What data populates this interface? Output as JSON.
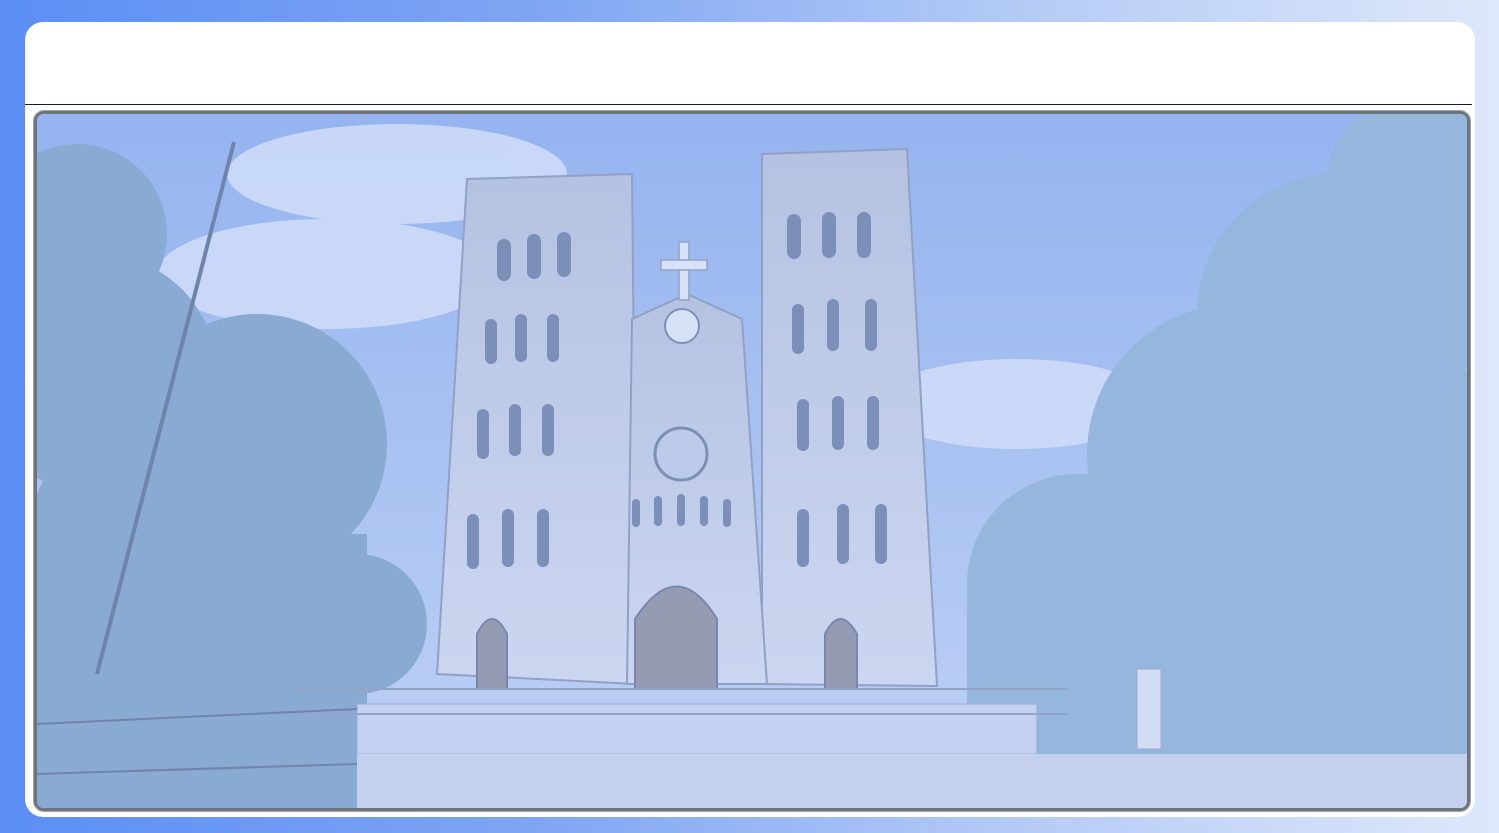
{
  "slide": {
    "title": "",
    "photo": {
      "subject": "cathedral-photo",
      "tint": "#a9c1f2"
    }
  },
  "colors": {
    "background_start": "#5b8ef5",
    "background_end": "#dde8fb",
    "card": "#ffffff",
    "rule": "#1b1b1b",
    "frame_border": "#6f737c"
  }
}
